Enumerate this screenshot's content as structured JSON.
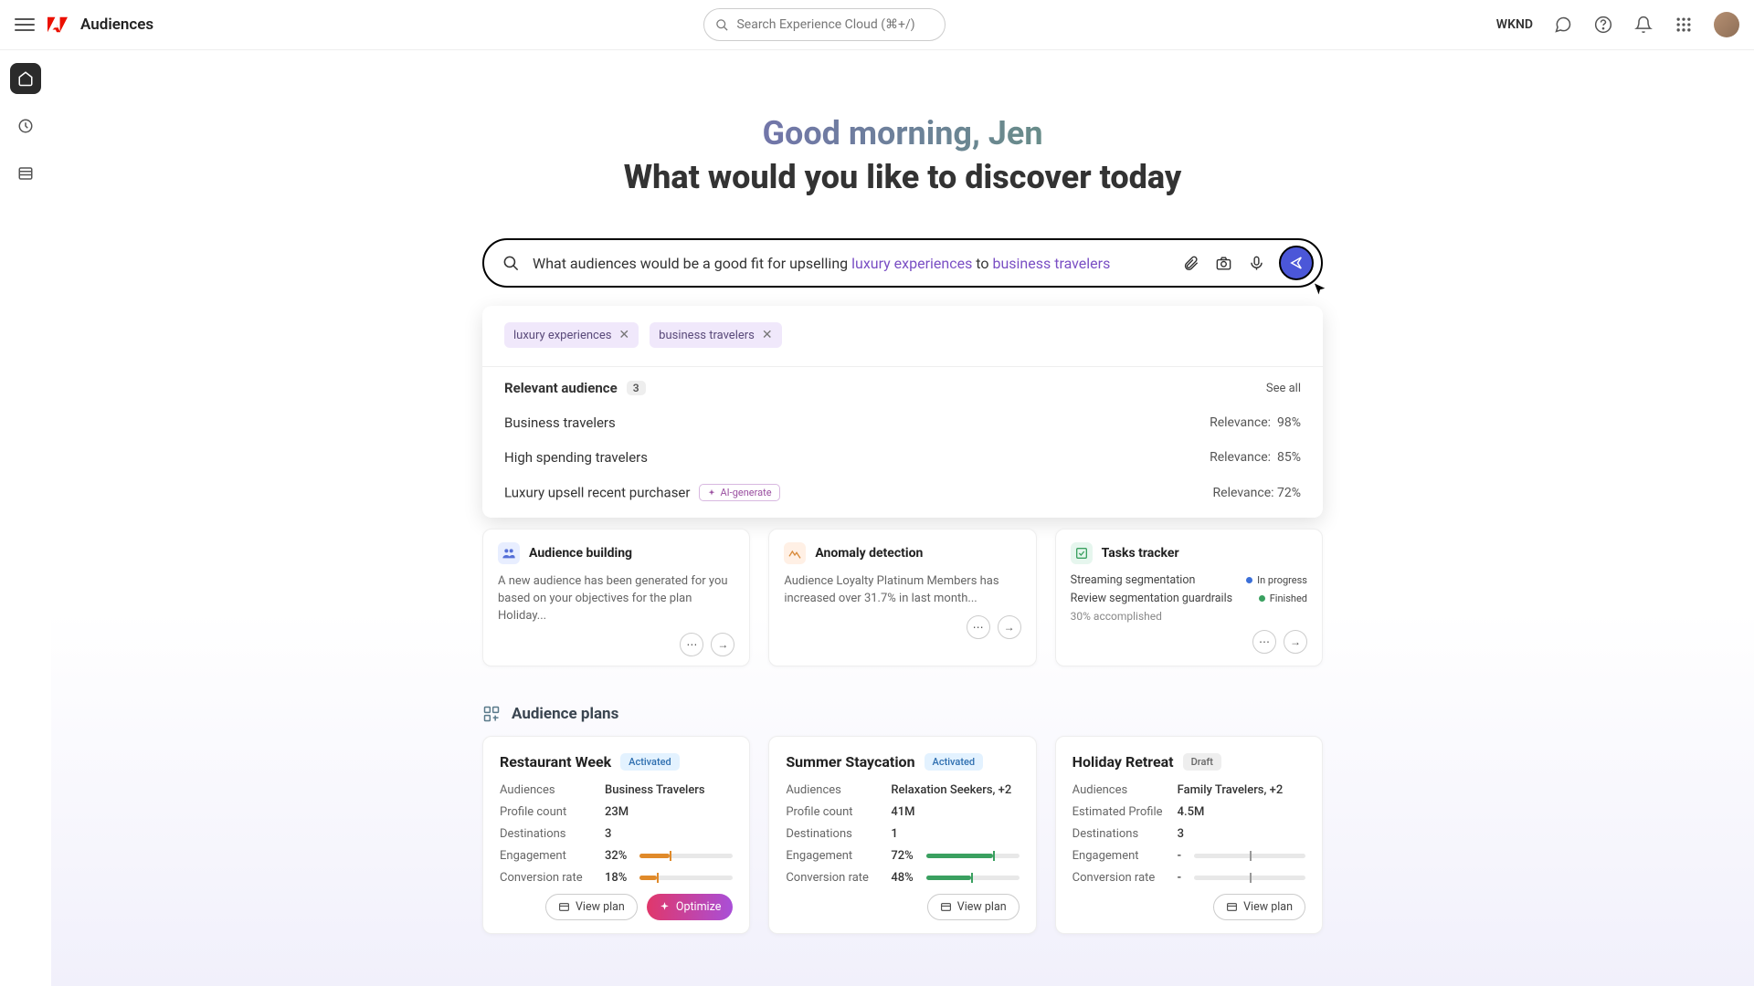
{
  "topbar": {
    "app_title": "Audiences",
    "search_placeholder": "Search Experience Cloud (⌘+/)",
    "tenant": "WKND"
  },
  "greeting": {
    "line1": "Good morning, Jen",
    "line2": "What would you like to discover today"
  },
  "ai_query": {
    "prefix": "What audiences would be a good fit for upselling ",
    "hl1": "luxury experiences",
    "mid": " to ",
    "hl2": "business travelers"
  },
  "chips": [
    {
      "label": "luxury experiences"
    },
    {
      "label": "business travelers"
    }
  ],
  "relevant": {
    "title": "Relevant audience",
    "count": "3",
    "see_all": "See all",
    "rows": [
      {
        "name": "Business travelers",
        "relevance_label": "Relevance:",
        "relevance_value": "98%"
      },
      {
        "name": "High spending travelers",
        "relevance_label": "Relevance:",
        "relevance_value": "85%"
      },
      {
        "name": "Luxury upsell recent purchaser",
        "relevance_label": "Relevance:",
        "relevance_value": "72%",
        "ai_badge": "AI-generate"
      }
    ]
  },
  "insights": {
    "audience_building": {
      "title": "Audience building",
      "body": "A new audience has been generated for you based on your objectives for the plan Holiday..."
    },
    "anomaly": {
      "title": "Anomaly detection",
      "body": "Audience Loyalty Platinum Members has increased over 31.7% in last month..."
    },
    "tasks": {
      "title": "Tasks tracker",
      "rows": [
        {
          "name": "Streaming segmentation",
          "status": "In progress",
          "color": "#3b6fd8"
        },
        {
          "name": "Review segmentation guardrails",
          "status": "Finished",
          "color": "#3aa060"
        }
      ],
      "accomplished": "30% accomplished"
    }
  },
  "plans": {
    "title": "Audience plans",
    "view_plan_label": "View plan",
    "optimize_label": "Optimize",
    "labels": {
      "audiences": "Audiences",
      "profile_count": "Profile count",
      "estimated_profile": "Estimated Profile",
      "destinations": "Destinations",
      "engagement": "Engagement",
      "conversion": "Conversion rate"
    },
    "cards": [
      {
        "name": "Restaurant Week",
        "status": "Activated",
        "status_class": "activated",
        "audiences": "Business Travelers",
        "profile_count": "23M",
        "destinations": "3",
        "engagement": "32%",
        "engagement_pct": 32,
        "engagement_color": "#e08a2a",
        "conversion": "18%",
        "conversion_pct": 18,
        "conversion_color": "#e08a2a",
        "has_optimize": true
      },
      {
        "name": "Summer Staycation",
        "status": "Activated",
        "status_class": "activated",
        "audiences": "Relaxation Seekers, +2",
        "profile_count": "41M",
        "destinations": "1",
        "engagement": "72%",
        "engagement_pct": 72,
        "engagement_color": "#3aa060",
        "conversion": "48%",
        "conversion_pct": 48,
        "conversion_color": "#3aa060",
        "has_optimize": false
      },
      {
        "name": "Holiday Retreat",
        "status": "Draft",
        "status_class": "draft",
        "audiences": "Family Travelers, +2",
        "estimated_profile": "4.5M",
        "destinations": "3",
        "engagement": "-",
        "conversion": "-",
        "has_optimize": false,
        "empty_bars": true
      }
    ]
  }
}
